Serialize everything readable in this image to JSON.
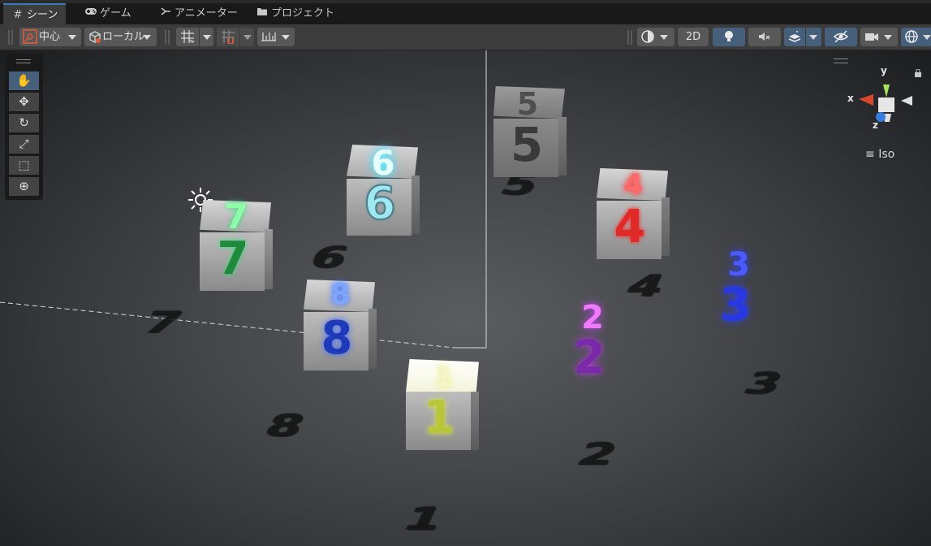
{
  "tabs": [
    {
      "label": "シーン",
      "icon": "scene-grid-icon",
      "active": true
    },
    {
      "label": "ゲーム",
      "icon": "gamepad-icon",
      "active": false
    },
    {
      "label": "アニメーター",
      "icon": "animator-icon",
      "active": false
    },
    {
      "label": "プロジェクト",
      "icon": "folder-icon",
      "active": false
    }
  ],
  "toolbar": {
    "pivot_label": "中心",
    "space_label": "ローカル",
    "mode_2d_label": "2D"
  },
  "gizmo": {
    "x_label": "x",
    "y_label": "y",
    "z_label": "z",
    "projection_label": "Iso"
  },
  "cubes": [
    {
      "label": "5",
      "color": "#3a3a3a"
    },
    {
      "label": "6",
      "color": "#9fe8f2"
    },
    {
      "label": "4",
      "color": "#e02a2a"
    },
    {
      "label": "7",
      "color": "#33e07a"
    },
    {
      "label": "8",
      "color": "#3d6cff"
    },
    {
      "label": "3",
      "color": "#2838e0"
    },
    {
      "label": "2",
      "color": "#b93ae6"
    },
    {
      "label": "1",
      "color": "#d8e64a"
    }
  ],
  "colors": {
    "accent": "#46607c",
    "tab_highlight": "#3a79bb"
  }
}
